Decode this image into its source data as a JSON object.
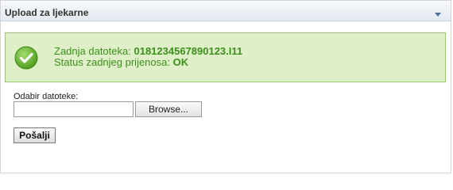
{
  "panel": {
    "title": "Upload za ljekarne",
    "collapse_icon": "chevron-down-icon"
  },
  "status": {
    "icon": "check-circle-icon",
    "file_label": "Zadnja datoteka:",
    "file_value": "0181234567890123.I11",
    "transfer_label": "Status zadnjeg prijenosa:",
    "transfer_value": "OK",
    "colors": {
      "background": "#dff0c9",
      "border": "#9cc56c",
      "text": "#3d8f1c"
    }
  },
  "form": {
    "file_label": "Odabir datoteke:",
    "file_value": "",
    "browse_label": "Browse...",
    "submit_label": "Pošalji"
  }
}
